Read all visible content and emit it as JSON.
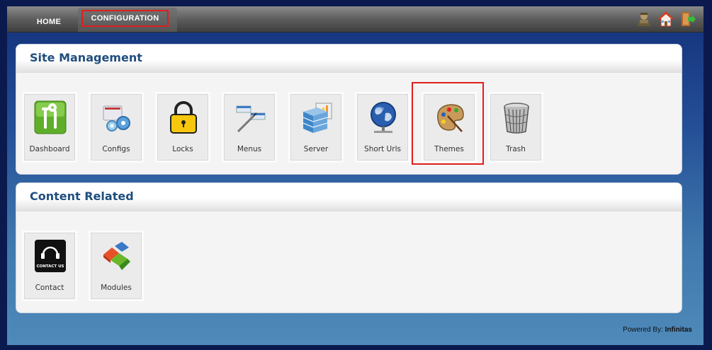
{
  "nav": {
    "tabs": [
      {
        "label": "HOME"
      },
      {
        "label": "CONFIGURATION"
      }
    ],
    "icons": [
      "user-icon",
      "home-icon",
      "logout-icon"
    ]
  },
  "panels": [
    {
      "title": "Site Management",
      "items": [
        {
          "label": "Dashboard",
          "icon": "dashboard-icon"
        },
        {
          "label": "Configs",
          "icon": "configs-icon"
        },
        {
          "label": "Locks",
          "icon": "lock-icon"
        },
        {
          "label": "Menus",
          "icon": "menus-icon"
        },
        {
          "label": "Server",
          "icon": "server-icon"
        },
        {
          "label": "Short Urls",
          "icon": "globe-icon"
        },
        {
          "label": "Themes",
          "icon": "palette-icon"
        },
        {
          "label": "Trash",
          "icon": "trash-icon"
        }
      ]
    },
    {
      "title": "Content Related",
      "items": [
        {
          "label": "Contact",
          "icon": "contact-icon"
        },
        {
          "label": "Modules",
          "icon": "modules-icon"
        }
      ]
    }
  ],
  "footer": {
    "powered_label": "Powered By:",
    "brand": "Infinitas"
  },
  "colors": {
    "title": "#1f4e7e",
    "highlight": "#e01e1e"
  }
}
